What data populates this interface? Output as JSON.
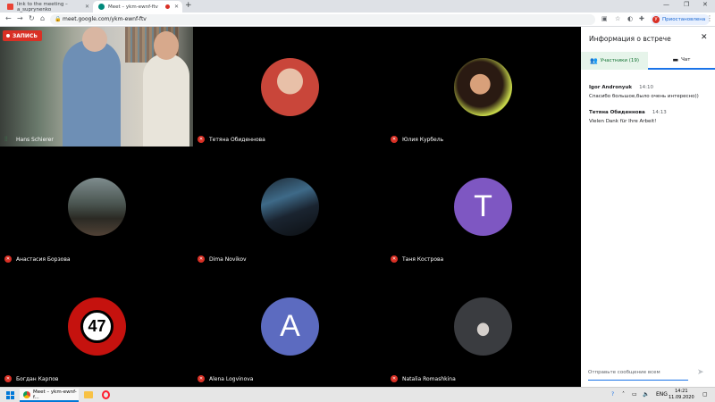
{
  "browser": {
    "tabs": [
      {
        "title": "link to the meeting – a_suprynenko"
      },
      {
        "title": "Meet – ykm-ewnf-ftv"
      }
    ],
    "url": "meet.google.com/ykm-ewnf-ftv",
    "profile_initial": "У",
    "profile_status": "Приостановлена"
  },
  "meet": {
    "recording_label": "ЗАПИСЬ",
    "tiles": [
      {
        "name": "Hans Schierer",
        "kind": "video"
      },
      {
        "name": "Тетяна Обиденнова",
        "kind": "photo",
        "color": "#c9463a"
      },
      {
        "name": "Юлия Курбель",
        "kind": "photo",
        "color": "#8a6a2d"
      },
      {
        "name": "Анастасия Борзова",
        "kind": "photo",
        "color": "#4a4d4a"
      },
      {
        "name": "Dima Novikov",
        "kind": "photo",
        "color": "#2c3a46"
      },
      {
        "name": "Таня Кострова",
        "kind": "letter",
        "letter": "T",
        "color": "#7e57c2"
      },
      {
        "name": "Богдан Карпов",
        "kind": "badge",
        "letter": "47",
        "color": "#c5120e"
      },
      {
        "name": "Alena Logvinova",
        "kind": "letter",
        "letter": "A",
        "color": "#5c6bc0"
      },
      {
        "name": "Natalia Romashkina",
        "kind": "photo",
        "color": "#3a3c40"
      }
    ]
  },
  "panel": {
    "title": "Информация о встрече",
    "tab_people": "Участники (19)",
    "tab_chat": "Чат",
    "messages": [
      {
        "author": "Igor Andronyuk",
        "time": "14:10",
        "text": "Спасибо большое,было очень интересно))"
      },
      {
        "author": "Тетяна Обиденнова",
        "time": "14:13",
        "text": "Vielen Dank für Ihre Arbeit!"
      }
    ],
    "compose_placeholder": "Отправьте сообщение всем"
  },
  "taskbar": {
    "app_label": "Meet – ykm-ewnf-f...",
    "lang": "ENG",
    "time": "14:21",
    "date": "11.09.2020"
  }
}
